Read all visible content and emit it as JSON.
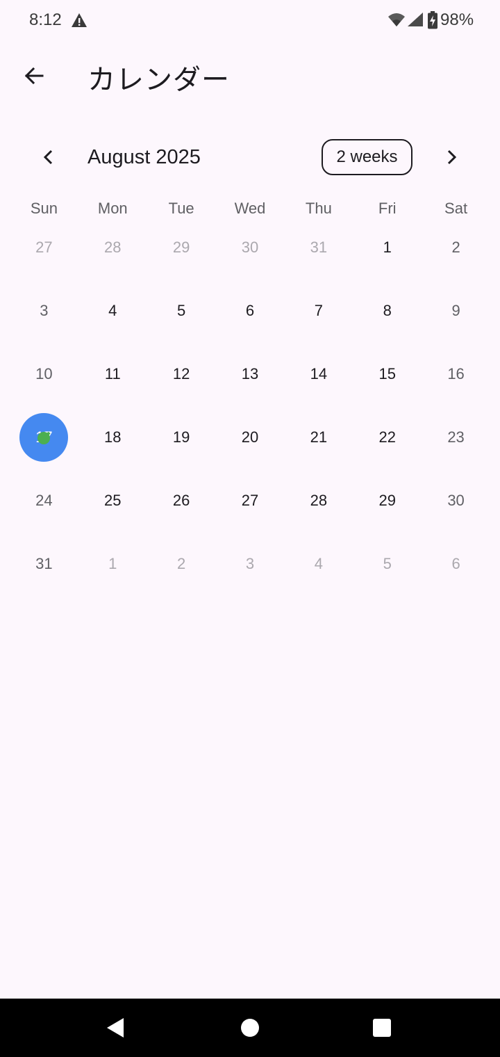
{
  "status_bar": {
    "time": "8:12",
    "battery": "98%",
    "icons": [
      "warning-icon",
      "wifi-icon",
      "signal-icon",
      "battery-charging-icon"
    ]
  },
  "app_bar": {
    "title": "カレンダー",
    "back_icon": "arrow-back-icon"
  },
  "calendar": {
    "month_title": "August 2025",
    "format_button": "2 weeks",
    "weekdays": [
      "Sun",
      "Mon",
      "Tue",
      "Wed",
      "Thu",
      "Fri",
      "Sat"
    ],
    "weeks": [
      [
        "27",
        "28",
        "29",
        "30",
        "31",
        "1",
        "2"
      ],
      [
        "3",
        "4",
        "5",
        "6",
        "7",
        "8",
        "9"
      ],
      [
        "10",
        "11",
        "12",
        "13",
        "14",
        "15",
        "16"
      ],
      [
        "17",
        "18",
        "19",
        "20",
        "21",
        "22",
        "23"
      ],
      [
        "24",
        "25",
        "26",
        "27",
        "28",
        "29",
        "30"
      ],
      [
        "31",
        "1",
        "2",
        "3",
        "4",
        "5",
        "6"
      ]
    ],
    "selected_day": "17",
    "colors": {
      "selected_fill": "#4589F0",
      "marker": "#4CAF50",
      "background": "#FDF7FD"
    }
  },
  "nav_bar": {
    "icons": [
      "nav-back-icon",
      "nav-home-icon",
      "nav-recents-icon"
    ]
  }
}
